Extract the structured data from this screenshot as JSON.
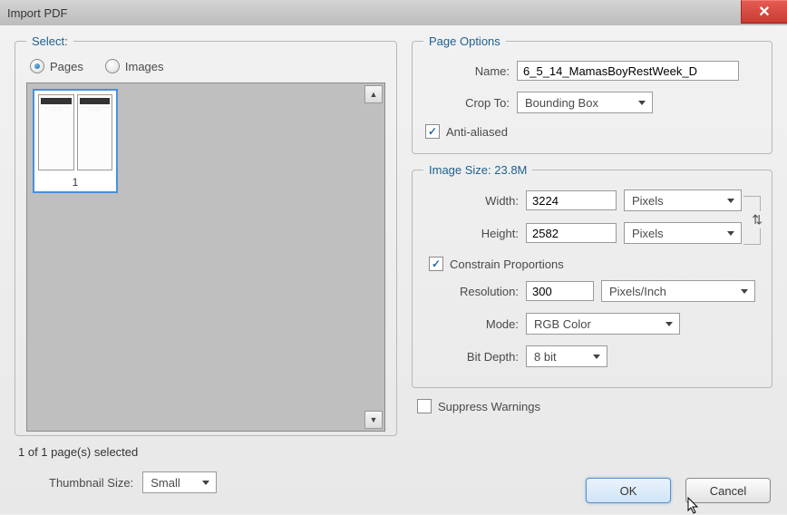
{
  "window_title": "Import PDF",
  "select": {
    "legend": "Select:",
    "radio_pages": "Pages",
    "radio_images": "Images",
    "thumb_label": "1",
    "selected_text": "1 of 1 page(s) selected",
    "thumb_size_label": "Thumbnail Size:",
    "thumb_size_value": "Small"
  },
  "page_options": {
    "legend": "Page Options",
    "name_label": "Name:",
    "name_value": "6_5_14_MamasBoyRestWeek_D",
    "crop_label": "Crop To:",
    "crop_value": "Bounding Box",
    "antialiased_label": "Anti-aliased"
  },
  "image_size": {
    "legend": "Image Size: 23.8M",
    "width_label": "Width:",
    "width_value": "3224",
    "width_unit": "Pixels",
    "height_label": "Height:",
    "height_value": "2582",
    "height_unit": "Pixels",
    "constrain_label": "Constrain Proportions",
    "resolution_label": "Resolution:",
    "resolution_value": "300",
    "resolution_unit": "Pixels/Inch",
    "mode_label": "Mode:",
    "mode_value": "RGB Color",
    "bitdepth_label": "Bit Depth:",
    "bitdepth_value": "8 bit"
  },
  "suppress_label": "Suppress Warnings",
  "ok_label": "OK",
  "cancel_label": "Cancel"
}
